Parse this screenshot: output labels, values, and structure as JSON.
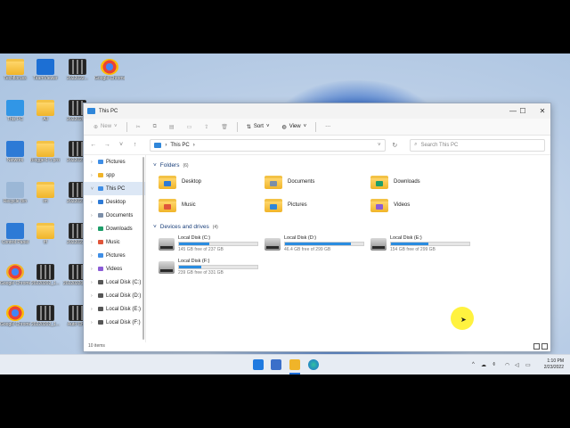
{
  "desktop_icons": [
    {
      "label": "Techfloruss",
      "kind": "folder"
    },
    {
      "label": "TeamViewer",
      "kind": "app"
    },
    {
      "label": "2022022...",
      "kind": "film"
    },
    {
      "label": "Google Chrome",
      "kind": "chrome"
    },
    {
      "label": "This PC",
      "kind": "pc"
    },
    {
      "label": "All",
      "kind": "folder"
    },
    {
      "label": "2022020...",
      "kind": "film"
    },
    {
      "label": "Network",
      "kind": "net"
    },
    {
      "label": "Blogger1 5 pro 2020",
      "kind": "folder"
    },
    {
      "label": "2022021...",
      "kind": "film"
    },
    {
      "label": "Recycle Bin",
      "kind": "bin"
    },
    {
      "label": "im",
      "kind": "folder"
    },
    {
      "label": "2022021...",
      "kind": "film"
    },
    {
      "label": "Control Panel",
      "kind": "cp"
    },
    {
      "label": "fff",
      "kind": "folder"
    },
    {
      "label": "2022022...",
      "kind": "film"
    },
    {
      "label": "Google Chrome Dev",
      "kind": "chromedev"
    },
    {
      "label": "20220202_1...",
      "kind": "film"
    },
    {
      "label": "20220220_1...",
      "kind": "film"
    },
    {
      "label": "Google Chrome",
      "kind": "chrome"
    },
    {
      "label": "20220202_1...",
      "kind": "film"
    },
    {
      "label": "Auto Ch...",
      "kind": "film"
    }
  ],
  "window": {
    "title": "This PC",
    "controls": {
      "minimize": "—",
      "maximize": "☐",
      "close": "✕"
    },
    "command_bar": {
      "new": "New",
      "sort": "Sort",
      "view": "View",
      "more": "···"
    },
    "address": {
      "root_symbol": "›",
      "path": "This PC",
      "sep": "›"
    },
    "search_placeholder": "Search This PC",
    "nav_pane": [
      {
        "label": "Pictures",
        "color": "#3f8ee6",
        "sel": false
      },
      {
        "label": "spp",
        "color": "#f0b429",
        "sel": false
      },
      {
        "label": "This PC",
        "color": "#3f8ee6",
        "sel": true
      },
      {
        "label": "Desktop",
        "color": "#2d7ad6",
        "sel": false
      },
      {
        "label": "Documents",
        "color": "#7b8ea8",
        "sel": false
      },
      {
        "label": "Downloads",
        "color": "#1e9e6a",
        "sel": false
      },
      {
        "label": "Music",
        "color": "#e0553a",
        "sel": false
      },
      {
        "label": "Pictures",
        "color": "#3f8ee6",
        "sel": false
      },
      {
        "label": "Videos",
        "color": "#8b5cd6",
        "sel": false
      },
      {
        "label": "Local Disk (C:)",
        "color": "#555555",
        "sel": false
      },
      {
        "label": "Local Disk (D:)",
        "color": "#555555",
        "sel": false
      },
      {
        "label": "Local Disk (E:)",
        "color": "#555555",
        "sel": false
      },
      {
        "label": "Local Disk (F:)",
        "color": "#555555",
        "sel": false
      }
    ],
    "folders_header": "Folders",
    "folders_count": "(6)",
    "folders": [
      {
        "name": "Desktop",
        "glyph_color": "#2d7ad6"
      },
      {
        "name": "Documents",
        "glyph_color": "#7b8ea8"
      },
      {
        "name": "Downloads",
        "glyph_color": "#1e9e6a"
      },
      {
        "name": "Music",
        "glyph_color": "#e0553a"
      },
      {
        "name": "Pictures",
        "glyph_color": "#2f86d9"
      },
      {
        "name": "Videos",
        "glyph_color": "#8b5cd6"
      }
    ],
    "drives_header": "Devices and drives",
    "drives_count": "(4)",
    "drives": [
      {
        "name": "Local Disk (C:)",
        "free": "145 GB free of 237 GB",
        "used_fraction": 0.39
      },
      {
        "name": "Local Disk (D:)",
        "free": "46.4 GB free of 299 GB",
        "used_fraction": 0.84
      },
      {
        "name": "Local Disk (E:)",
        "free": "154 GB free of 299 GB",
        "used_fraction": 0.48
      },
      {
        "name": "Local Disk (F:)",
        "free": "239 GB free of 331 GB",
        "used_fraction": 0.28
      }
    ],
    "status": "10 items"
  },
  "taskbar": {
    "clock_time": "1:10 PM",
    "clock_date": "2/23/2022",
    "tray_chevron": "^"
  }
}
